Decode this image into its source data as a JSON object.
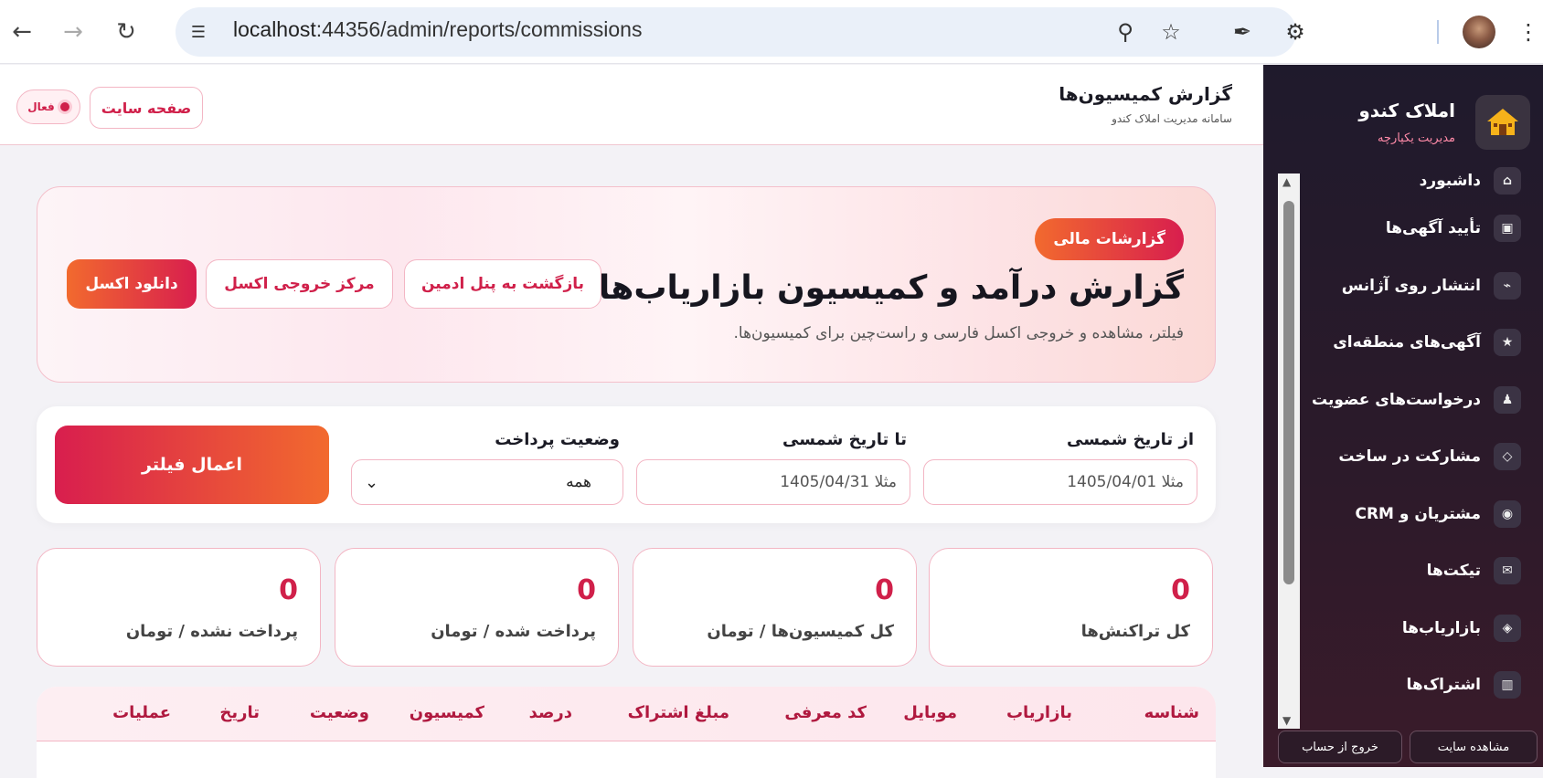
{
  "browser": {
    "url_host": "localhost",
    "url_path": ":44356/admin/reports/commissions"
  },
  "sidebar": {
    "brand_title": "املاک کندو",
    "brand_sub": "مدیریت یکپارچه",
    "items": [
      {
        "label": "داشبورد",
        "icon": "⌂"
      },
      {
        "label": "تأیید آگهی‌ها",
        "icon": "▣"
      },
      {
        "label": "انتشار روی آژانس",
        "icon": "⌁"
      },
      {
        "label": "آگهی‌های منطقه‌ای",
        "icon": "★"
      },
      {
        "label": "درخواست‌های عضویت",
        "icon": "♟"
      },
      {
        "label": "مشارکت در ساخت",
        "icon": "◇"
      },
      {
        "label": "مشتریان و CRM",
        "icon": "◉"
      },
      {
        "label": "تیکت‌ها",
        "icon": "✉"
      },
      {
        "label": "بازاریاب‌ها",
        "icon": "◈"
      },
      {
        "label": "اشتراک‌ها",
        "icon": "▥"
      }
    ],
    "view_site": "مشاهده سایت",
    "logout": "خروج از حساب"
  },
  "header": {
    "title": "گزارش کمیسیون‌ها",
    "subtitle": "سامانه مدیریت املاک کندو",
    "site_button": "صفحه سایت",
    "status": "فعال"
  },
  "hero": {
    "chip": "گزارشات مالی",
    "title": "گزارش درآمد و کمیسیون بازاریاب‌ها",
    "description": "فیلتر، مشاهده و خروجی اکسل فارسی و راست‌چین برای کمیسیون‌ها.",
    "back_button": "بازگشت به پنل ادمین",
    "export_center_button": "مرکز خروجی اکسل",
    "download_button": "دانلود اکسل"
  },
  "filters": {
    "from_label": "از تاریخ شمسی",
    "from_placeholder": "مثلا 1405/04/01",
    "to_label": "تا تاریخ شمسی",
    "to_placeholder": "مثلا 1405/04/31",
    "status_label": "وضعیت پرداخت",
    "status_value": "همه",
    "apply_button": "اعمال فیلتر"
  },
  "stats": [
    {
      "value": "0",
      "label": "کل تراکنش‌ها"
    },
    {
      "value": "0",
      "label": "کل کمیسیون‌ها / تومان"
    },
    {
      "value": "0",
      "label": "پرداخت شده / تومان"
    },
    {
      "value": "0",
      "label": "پرداخت نشده / تومان"
    }
  ],
  "table": {
    "columns": [
      "شناسه",
      "بازاریاب",
      "موبایل",
      "کد معرفی",
      "مبلغ اشتراک",
      "درصد",
      "کمیسیون",
      "وضعیت",
      "تاریخ",
      "عملیات"
    ]
  },
  "colors": {
    "accent": "#d0204a",
    "accent_orange": "#f26a2e",
    "sidebar_bg": "#1f1a2c"
  }
}
